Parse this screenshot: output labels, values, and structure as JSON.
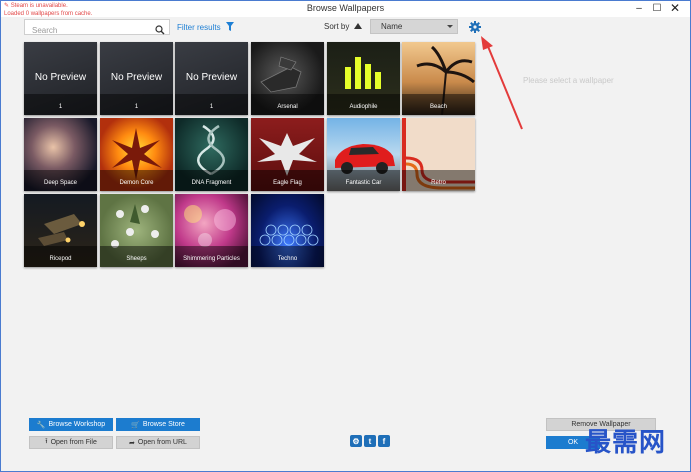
{
  "window": {
    "title": "Browse Wallpapers",
    "controls": [
      "–",
      "☐",
      "✕"
    ]
  },
  "status": {
    "line1": "Steam is unavailable.",
    "line2": "Loaded 0 wallpapers from cache."
  },
  "search": {
    "placeholder": "Search"
  },
  "filter": {
    "label": "Filter results"
  },
  "sort": {
    "label": "Sort by",
    "selected": "Name"
  },
  "placeholder_text": "Please select a wallpaper",
  "tiles": [
    {
      "name": "No Preview",
      "label": "1"
    },
    {
      "name": "No Preview",
      "label": "1"
    },
    {
      "name": "No Preview",
      "label": "1"
    },
    {
      "name": "",
      "label": "Arsenal"
    },
    {
      "name": "",
      "label": "Audiophile"
    },
    {
      "name": "",
      "label": "Beach"
    },
    {
      "name": "",
      "label": "Deep Space"
    },
    {
      "name": "",
      "label": "Demon Core"
    },
    {
      "name": "",
      "label": "DNA Fragment"
    },
    {
      "name": "",
      "label": "Eagle Flag"
    },
    {
      "name": "",
      "label": "Fantastic Car"
    },
    {
      "name": "",
      "label": "Retro"
    },
    {
      "name": "",
      "label": "Ricepod"
    },
    {
      "name": "",
      "label": "Sheeps"
    },
    {
      "name": "",
      "label": "Shimmering Particles"
    },
    {
      "name": "",
      "label": "Techno"
    }
  ],
  "buttons": {
    "browse_workshop": "Browse Workshop",
    "browse_store": "Browse Store",
    "open_file": "Open from File",
    "open_url": "Open from URL",
    "remove_wallpaper": "Remove Wallpaper",
    "ok": "OK"
  },
  "watermark": "最需网",
  "colors": {
    "accent": "#1c7ccf",
    "status": "#e24848",
    "watermark": "#2754c8"
  }
}
